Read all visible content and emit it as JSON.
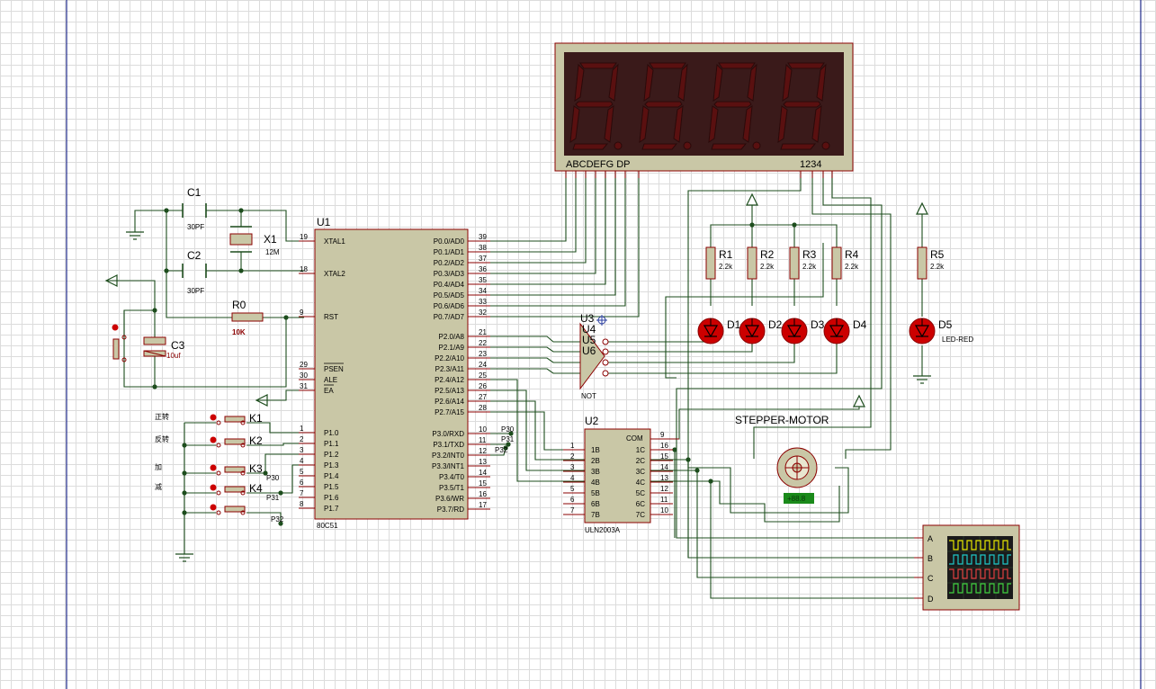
{
  "mcu": {
    "ref": "U1",
    "type": "80C51",
    "left_pins": [
      {
        "num": "19",
        "name": "XTAL1"
      },
      {
        "num": "18",
        "name": "XTAL2"
      },
      {
        "num": "9",
        "name": "RST"
      },
      {
        "num": "29",
        "name": "PSEN"
      },
      {
        "num": "30",
        "name": "ALE"
      },
      {
        "num": "31",
        "name": "EA"
      },
      {
        "num": "1",
        "name": "P1.0"
      },
      {
        "num": "2",
        "name": "P1.1"
      },
      {
        "num": "3",
        "name": "P1.2"
      },
      {
        "num": "4",
        "name": "P1.3"
      },
      {
        "num": "5",
        "name": "P1.4"
      },
      {
        "num": "6",
        "name": "P1.5"
      },
      {
        "num": "7",
        "name": "P1.6"
      },
      {
        "num": "8",
        "name": "P1.7"
      }
    ],
    "right_pins": [
      {
        "num": "39",
        "name": "P0.0/AD0"
      },
      {
        "num": "38",
        "name": "P0.1/AD1"
      },
      {
        "num": "37",
        "name": "P0.2/AD2"
      },
      {
        "num": "36",
        "name": "P0.3/AD3"
      },
      {
        "num": "35",
        "name": "P0.4/AD4"
      },
      {
        "num": "34",
        "name": "P0.5/AD5"
      },
      {
        "num": "33",
        "name": "P0.6/AD6"
      },
      {
        "num": "32",
        "name": "P0.7/AD7"
      },
      {
        "num": "21",
        "name": "P2.0/A8"
      },
      {
        "num": "22",
        "name": "P2.1/A9"
      },
      {
        "num": "23",
        "name": "P2.2/A10"
      },
      {
        "num": "24",
        "name": "P2.3/A11"
      },
      {
        "num": "25",
        "name": "P2.4/A12"
      },
      {
        "num": "26",
        "name": "P2.5/A13"
      },
      {
        "num": "27",
        "name": "P2.6/A14"
      },
      {
        "num": "28",
        "name": "P2.7/A15"
      },
      {
        "num": "10",
        "name": "P3.0/RXD"
      },
      {
        "num": "11",
        "name": "P3.1/TXD"
      },
      {
        "num": "12",
        "name": "P3.2/INT0"
      },
      {
        "num": "13",
        "name": "P3.3/INT1"
      },
      {
        "num": "14",
        "name": "P3.4/T0"
      },
      {
        "num": "15",
        "name": "P3.5/T1"
      },
      {
        "num": "16",
        "name": "P3.6/WR"
      },
      {
        "num": "17",
        "name": "P3.7/RD"
      }
    ]
  },
  "crystal": {
    "ref": "X1",
    "value": "12M"
  },
  "caps": [
    {
      "ref": "C1",
      "value": "30PF"
    },
    {
      "ref": "C2",
      "value": "30PF"
    },
    {
      "ref": "C3",
      "value": "10uf"
    }
  ],
  "reset_resistor": {
    "ref": "R0",
    "value": "10K"
  },
  "display": {
    "segment_label": "ABCDEFG  DP",
    "digit_label": "1234",
    "digits": 4
  },
  "resistors": [
    {
      "ref": "R1",
      "value": "2.2k"
    },
    {
      "ref": "R2",
      "value": "2.2k"
    },
    {
      "ref": "R3",
      "value": "2.2k"
    },
    {
      "ref": "R4",
      "value": "2.2k"
    },
    {
      "ref": "R5",
      "value": "2.2k"
    }
  ],
  "leds": [
    {
      "ref": "D1",
      "value": ""
    },
    {
      "ref": "D2",
      "value": ""
    },
    {
      "ref": "D3",
      "value": ""
    },
    {
      "ref": "D4",
      "value": ""
    },
    {
      "ref": "D5",
      "value": "LED-RED"
    }
  ],
  "inverters": {
    "refs": [
      "U3",
      "U4",
      "U5",
      "U6"
    ],
    "type": "NOT"
  },
  "driver": {
    "ref": "U2",
    "type": "ULN2003A",
    "com": "COM",
    "com_pin": "9",
    "inputs": [
      {
        "num": "1",
        "name": "1B"
      },
      {
        "num": "2",
        "name": "2B"
      },
      {
        "num": "3",
        "name": "3B"
      },
      {
        "num": "4",
        "name": "4B"
      },
      {
        "num": "5",
        "name": "5B"
      },
      {
        "num": "6",
        "name": "6B"
      },
      {
        "num": "7",
        "name": "7B"
      }
    ],
    "outputs": [
      {
        "num": "16",
        "name": "1C"
      },
      {
        "num": "15",
        "name": "2C"
      },
      {
        "num": "14",
        "name": "3C"
      },
      {
        "num": "13",
        "name": "4C"
      },
      {
        "num": "12",
        "name": "5C"
      },
      {
        "num": "11",
        "name": "6C"
      },
      {
        "num": "10",
        "name": "7C"
      }
    ]
  },
  "motor": {
    "label": "STEPPER-MOTOR",
    "readout": "+88.8"
  },
  "keys": [
    {
      "ref": "K1",
      "label": "正转"
    },
    {
      "ref": "K2",
      "label": "反转"
    },
    {
      "ref": "K3",
      "label": "加"
    },
    {
      "ref": "K4",
      "label": "减"
    },
    {
      "ref": "",
      "label": ""
    }
  ],
  "port_tags": [
    "P30",
    "P31",
    "P32"
  ],
  "scope_channels": [
    "A",
    "B",
    "C",
    "D"
  ],
  "colors": {
    "wire": "#1d4d1d",
    "comp_outline": "#8b0000",
    "comp_fill": "#c9c7a6",
    "pin_text": "#000000",
    "display_bg": "#3a1a1a",
    "segment": "#5a1010",
    "led_fill": "#cc0000"
  }
}
